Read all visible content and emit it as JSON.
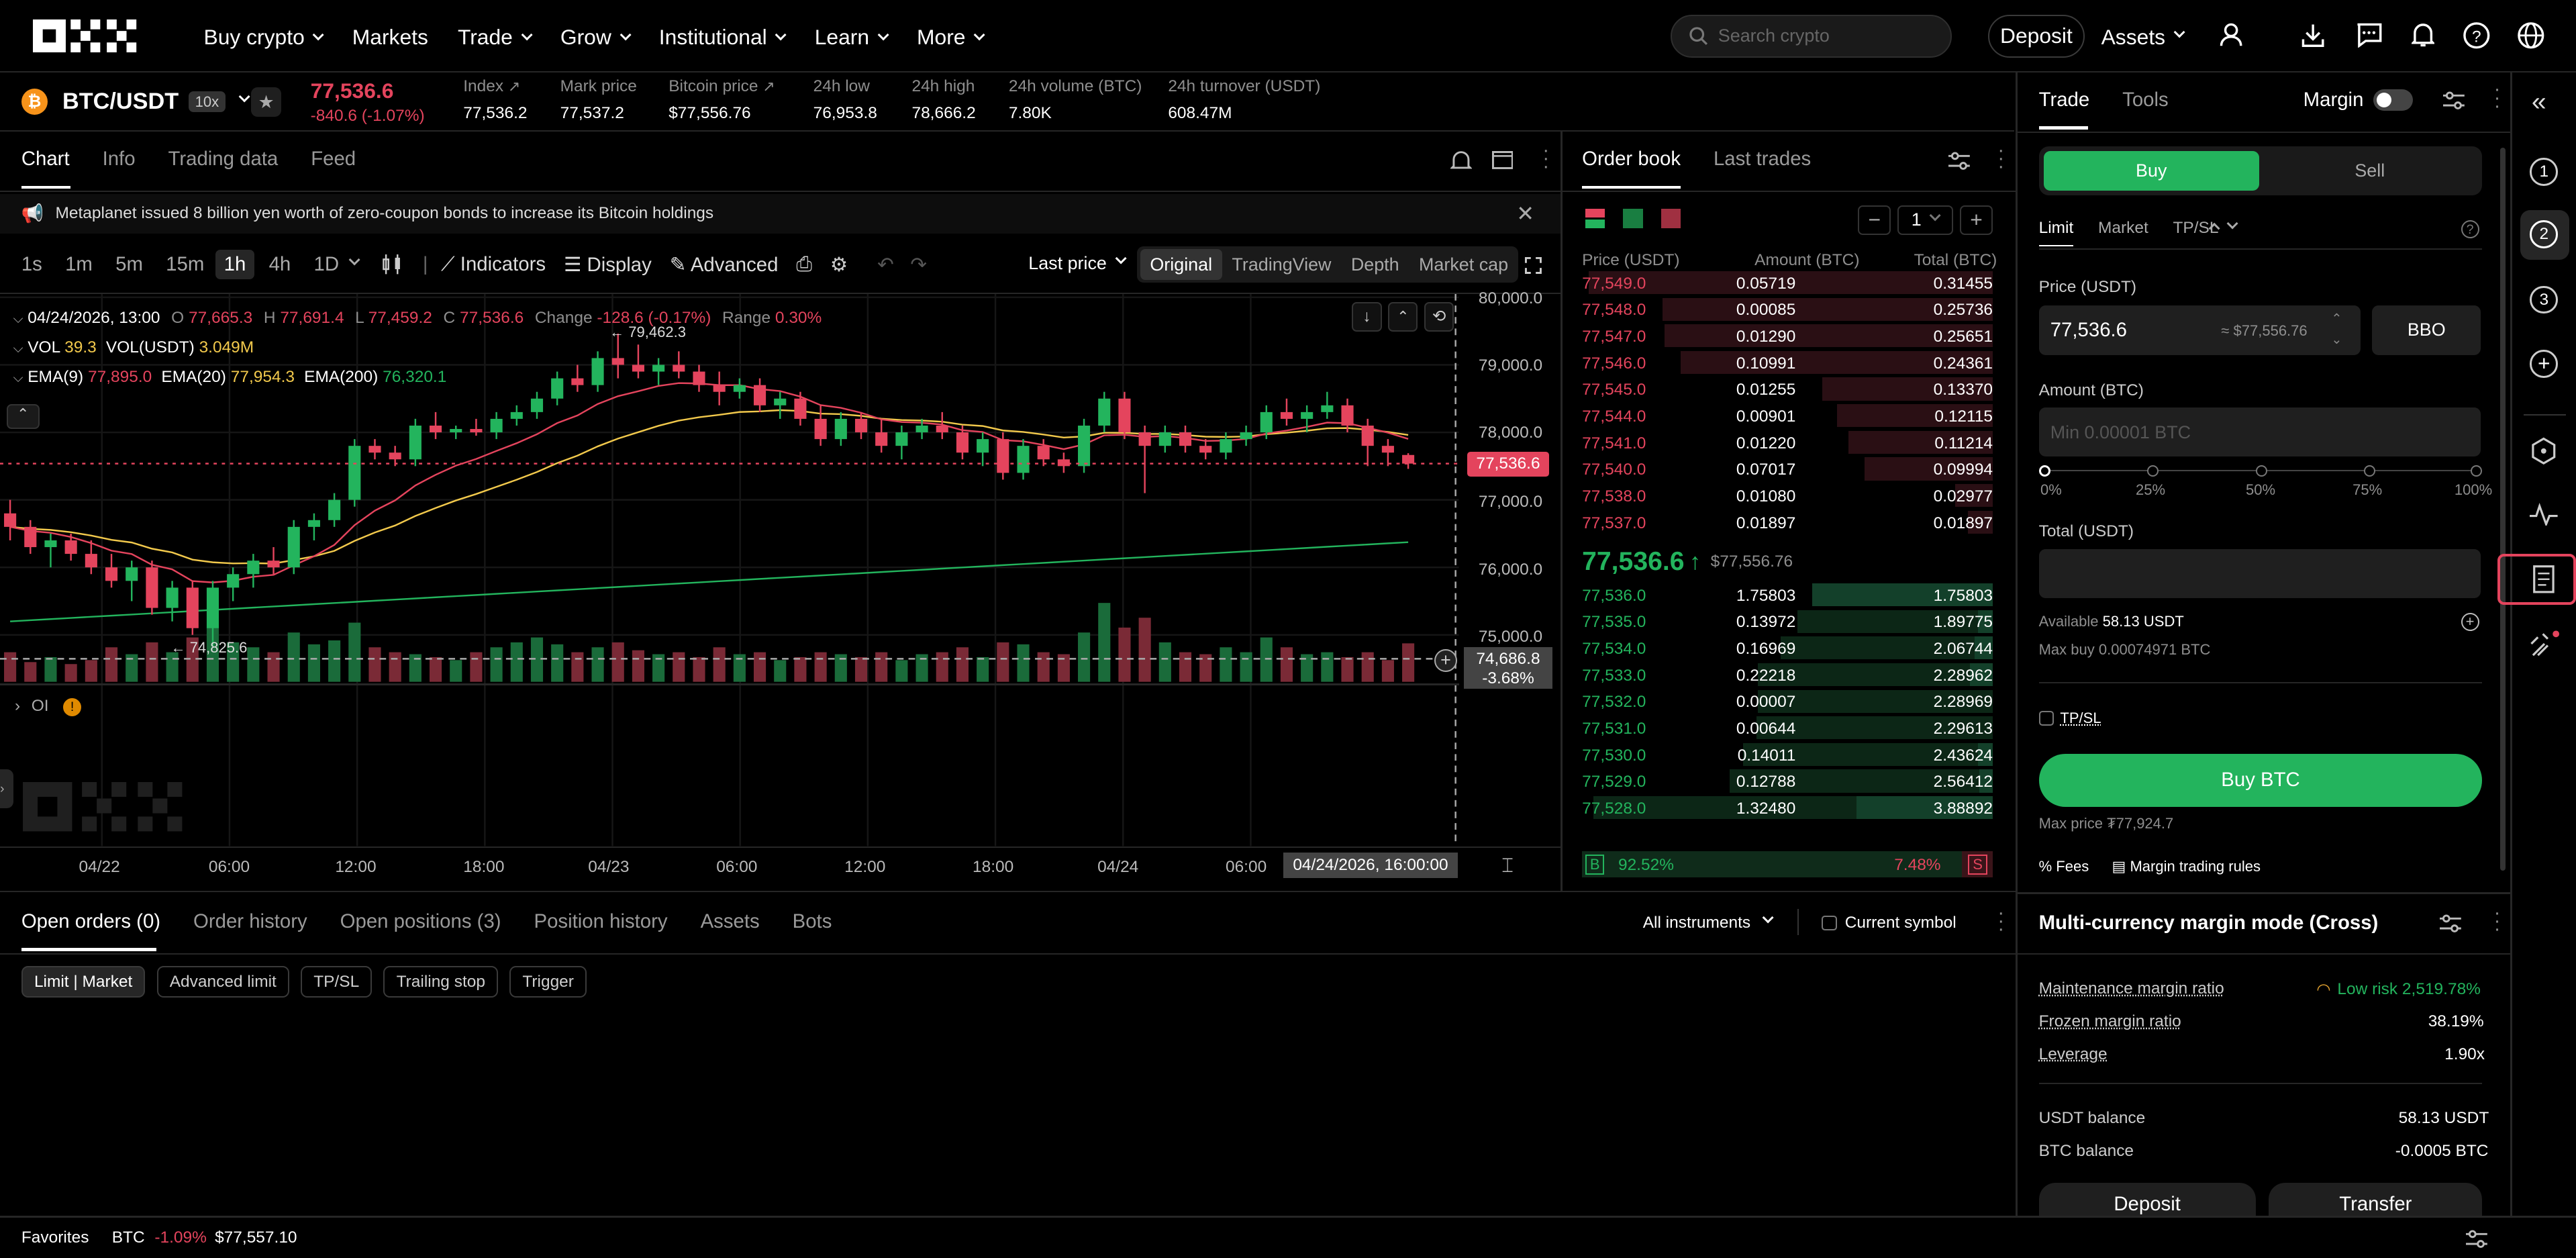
{
  "nav": {
    "logo": "OKX",
    "items": [
      "Buy crypto",
      "Markets",
      "Trade",
      "Grow",
      "Institutional",
      "Learn",
      "More"
    ],
    "search_placeholder": "Search crypto",
    "deposit": "Deposit",
    "assets": "Assets"
  },
  "ticker": {
    "pair": "BTC/USDT",
    "leverage": "10x",
    "price": "77,536.6",
    "change": "-840.6 (-1.07%)",
    "stats": [
      {
        "label": "Index",
        "value": "77,536.2"
      },
      {
        "label": "Mark price",
        "value": "77,537.2"
      },
      {
        "label": "Bitcoin price",
        "value": "$77,556.76"
      },
      {
        "label": "24h low",
        "value": "76,953.8"
      },
      {
        "label": "24h high",
        "value": "78,666.2"
      },
      {
        "label": "24h volume (BTC)",
        "value": "7.80K"
      },
      {
        "label": "24h turnover (USDT)",
        "value": "608.47M"
      }
    ]
  },
  "chart_panel": {
    "tabs": [
      "Chart",
      "Info",
      "Trading data",
      "Feed"
    ],
    "news": "Metaplanet issued 8 billion yen worth of zero-coupon bonds to increase its Bitcoin holdings",
    "intervals": [
      "1s",
      "1m",
      "5m",
      "15m",
      "1h",
      "4h",
      "1D"
    ],
    "tools": [
      "Indicators",
      "Display",
      "Advanced"
    ],
    "price_mode": "Last price",
    "views": [
      "Original",
      "TradingView",
      "Depth",
      "Market cap"
    ],
    "ohlc": {
      "date": "04/24/2026, 13:00",
      "o": "77,665.3",
      "h": "77,691.4",
      "l": "77,459.2",
      "c": "77,536.6",
      "change": "-128.6 (-0.17%)",
      "range": "0.30%"
    },
    "vol": {
      "label": "VOL",
      "btc": "39.3",
      "usdt_label": "VOL(USDT)",
      "usdt": "3.049M"
    },
    "ema": [
      {
        "label": "EMA(9)",
        "value": "77,895.0",
        "color": "#e4445d"
      },
      {
        "label": "EMA(20)",
        "value": "77,954.3",
        "color": "#f2c94c"
      },
      {
        "label": "EMA(200)",
        "value": "76,320.1",
        "color": "#23b45d"
      }
    ],
    "high_marker": "79,462.3",
    "low_marker": "74,825.6",
    "oi": "OI",
    "y_ticks": [
      "80,000.0",
      "79,000.0",
      "78,000.0",
      "77,000.0",
      "76,000.0",
      "75,000.0"
    ],
    "last_price_tag": "77,536.6",
    "cursor_price": "74,686.8",
    "cursor_pct": "-3.68%",
    "x_ticks": [
      "04/22",
      "06:00",
      "12:00",
      "18:00",
      "04/23",
      "06:00",
      "12:00",
      "18:00",
      "04/24",
      "06:00"
    ],
    "cursor_time": "04/24/2026, 16:00:00"
  },
  "chart_data": {
    "type": "candlestick",
    "title": "BTC/USDT 1h",
    "ylim": [
      74500,
      80000
    ],
    "candles": [
      [
        76800,
        77000,
        76400,
        76600
      ],
      [
        76600,
        76700,
        76200,
        76300
      ],
      [
        76300,
        76500,
        76000,
        76400
      ],
      [
        76400,
        76500,
        76100,
        76200
      ],
      [
        76200,
        76400,
        75900,
        76000
      ],
      [
        76000,
        76200,
        75700,
        75800
      ],
      [
        75800,
        76100,
        75500,
        76000
      ],
      [
        76000,
        76100,
        75300,
        75400
      ],
      [
        75400,
        75800,
        75200,
        75700
      ],
      [
        75700,
        75800,
        75000,
        75100
      ],
      [
        75100,
        75800,
        74826,
        75700
      ],
      [
        75700,
        76000,
        75500,
        75900
      ],
      [
        75900,
        76200,
        75700,
        76100
      ],
      [
        76100,
        76300,
        75900,
        76000
      ],
      [
        76000,
        76700,
        75900,
        76600
      ],
      [
        76600,
        76800,
        76400,
        76700
      ],
      [
        76700,
        77100,
        76600,
        77000
      ],
      [
        77000,
        77900,
        76900,
        77800
      ],
      [
        77800,
        77900,
        77600,
        77700
      ],
      [
        77700,
        77800,
        77500,
        77600
      ],
      [
        77600,
        78200,
        77500,
        78100
      ],
      [
        78100,
        78300,
        77900,
        78000
      ],
      [
        78000,
        78100,
        77900,
        78050
      ],
      [
        78050,
        78200,
        77950,
        78000
      ],
      [
        78000,
        78300,
        77900,
        78200
      ],
      [
        78200,
        78400,
        78100,
        78300
      ],
      [
        78300,
        78600,
        78200,
        78500
      ],
      [
        78500,
        78900,
        78400,
        78800
      ],
      [
        78800,
        79000,
        78600,
        78700
      ],
      [
        78700,
        79200,
        78600,
        79100
      ],
      [
        79100,
        79462,
        78800,
        79000
      ],
      [
        79000,
        79300,
        78800,
        78900
      ],
      [
        78900,
        79100,
        78700,
        79000
      ],
      [
        79000,
        79200,
        78800,
        78900
      ],
      [
        78900,
        79000,
        78600,
        78700
      ],
      [
        78700,
        78900,
        78400,
        78600
      ],
      [
        78600,
        78800,
        78500,
        78700
      ],
      [
        78700,
        78800,
        78300,
        78400
      ],
      [
        78400,
        78600,
        78200,
        78500
      ],
      [
        78500,
        78600,
        78100,
        78200
      ],
      [
        78200,
        78400,
        77800,
        77900
      ],
      [
        77900,
        78300,
        77800,
        78200
      ],
      [
        78200,
        78300,
        77900,
        78000
      ],
      [
        78000,
        78200,
        77700,
        77800
      ],
      [
        77800,
        78100,
        77600,
        78000
      ],
      [
        78000,
        78200,
        77900,
        78100
      ],
      [
        78100,
        78300,
        77900,
        78000
      ],
      [
        78000,
        78100,
        77600,
        77700
      ],
      [
        77700,
        78000,
        77500,
        77900
      ],
      [
        77900,
        78000,
        77300,
        77400
      ],
      [
        77400,
        77900,
        77300,
        77800
      ],
      [
        77800,
        77900,
        77500,
        77600
      ],
      [
        77600,
        77700,
        77400,
        77500
      ],
      [
        77500,
        78200,
        77400,
        78100
      ],
      [
        78100,
        78600,
        78000,
        78500
      ],
      [
        78500,
        78600,
        77900,
        78000
      ],
      [
        78000,
        78100,
        77100,
        77800
      ],
      [
        77800,
        78100,
        77700,
        78000
      ],
      [
        78000,
        78100,
        77700,
        77800
      ],
      [
        77800,
        77900,
        77600,
        77700
      ],
      [
        77700,
        78000,
        77600,
        77900
      ],
      [
        77900,
        78100,
        77800,
        78000
      ],
      [
        78000,
        78400,
        77900,
        78300
      ],
      [
        78300,
        78500,
        78100,
        78200
      ],
      [
        78200,
        78400,
        78000,
        78300
      ],
      [
        78300,
        78600,
        78200,
        78400
      ],
      [
        78400,
        78500,
        78000,
        78100
      ],
      [
        78100,
        78200,
        77500,
        77800
      ],
      [
        77800,
        77900,
        77500,
        77700
      ],
      [
        77665,
        77691,
        77459,
        77537
      ]
    ],
    "volume": [
      30,
      20,
      25,
      18,
      22,
      35,
      28,
      40,
      30,
      45,
      55,
      40,
      35,
      30,
      50,
      38,
      42,
      60,
      35,
      30,
      28,
      25,
      22,
      30,
      35,
      40,
      45,
      38,
      30,
      35,
      40,
      32,
      28,
      30,
      25,
      35,
      28,
      30,
      22,
      25,
      30,
      28,
      25,
      30,
      22,
      28,
      30,
      35,
      25,
      40,
      38,
      30,
      28,
      50,
      80,
      55,
      65,
      40,
      30,
      28,
      35,
      30,
      45,
      35,
      28,
      30,
      25,
      30,
      22,
      39
    ]
  },
  "order_book": {
    "tabs": [
      "Order book",
      "Last trades"
    ],
    "precision": "1",
    "headers": [
      "Price (USDT)",
      "Amount (BTC)",
      "Total (BTC)"
    ],
    "asks": [
      [
        "77,549.0",
        "0.05719",
        "0.31455"
      ],
      [
        "77,548.0",
        "0.00085",
        "0.25736"
      ],
      [
        "77,547.0",
        "0.01290",
        "0.25651"
      ],
      [
        "77,546.0",
        "0.10991",
        "0.24361"
      ],
      [
        "77,545.0",
        "0.01255",
        "0.13370"
      ],
      [
        "77,544.0",
        "0.00901",
        "0.12115"
      ],
      [
        "77,541.0",
        "0.01220",
        "0.11214"
      ],
      [
        "77,540.0",
        "0.07017",
        "0.09994"
      ],
      [
        "77,538.0",
        "0.01080",
        "0.02977"
      ],
      [
        "77,537.0",
        "0.01897",
        "0.01897"
      ]
    ],
    "mid_price": "77,536.6",
    "mid_usd": "$77,556.76",
    "bids": [
      [
        "77,536.0",
        "1.75803",
        "1.75803"
      ],
      [
        "77,535.0",
        "0.13972",
        "1.89775"
      ],
      [
        "77,534.0",
        "0.16969",
        "2.06744"
      ],
      [
        "77,533.0",
        "0.22218",
        "2.28962"
      ],
      [
        "77,532.0",
        "0.00007",
        "2.28969"
      ],
      [
        "77,531.0",
        "0.00644",
        "2.29613"
      ],
      [
        "77,530.0",
        "0.14011",
        "2.43624"
      ],
      [
        "77,529.0",
        "0.12788",
        "2.56412"
      ],
      [
        "77,528.0",
        "1.32480",
        "3.88892"
      ]
    ],
    "buy_pct": "92.52%",
    "sell_pct": "7.48%",
    "b": "B",
    "s": "S"
  },
  "trade_panel": {
    "tabs": [
      "Trade",
      "Tools"
    ],
    "margin_label": "Margin",
    "buy": "Buy",
    "sell": "Sell",
    "order_types": [
      "Limit",
      "Market",
      "TP/SL"
    ],
    "price_label": "Price (USDT)",
    "price_value": "77,536.6",
    "price_usd": "≈ $77,556.76",
    "bbo": "BBO",
    "amount_label": "Amount (BTC)",
    "amount_placeholder": "Min 0.00001 BTC",
    "slider": [
      "0%",
      "25%",
      "50%",
      "75%",
      "100%"
    ],
    "total_label": "Total (USDT)",
    "available_label": "Available",
    "available": "58.13 USDT",
    "max_buy": "Max buy 0.00074971 BTC",
    "tpsl": "TP/SL",
    "buy_button": "Buy BTC",
    "max_price": "Max price ₮77,924.7",
    "fees": "Fees",
    "rules": "Margin trading rules"
  },
  "margin_panel": {
    "title": "Multi-currency margin mode (Cross)",
    "rows": [
      {
        "label": "Maintenance margin ratio",
        "value": "Low risk 2,519.78%"
      },
      {
        "label": "Frozen margin ratio",
        "value": "38.19%"
      },
      {
        "label": "Leverage",
        "value": "1.90x"
      }
    ],
    "balances": [
      {
        "label": "USDT balance",
        "value": "58.13 USDT"
      },
      {
        "label": "BTC balance",
        "value": "-0.0005 BTC"
      }
    ],
    "deposit": "Deposit",
    "transfer": "Transfer"
  },
  "orders": {
    "tabs": [
      "Open orders (0)",
      "Order history",
      "Open positions (3)",
      "Position history",
      "Assets",
      "Bots"
    ],
    "filter": "All instruments",
    "current_symbol": "Current symbol",
    "chips": [
      "Limit | Market",
      "Advanced limit",
      "TP/SL",
      "Trailing stop",
      "Trigger"
    ]
  },
  "footer": {
    "favorites": "Favorites",
    "sym": "BTC",
    "change": "-1.09%",
    "price": "$77,557.10"
  },
  "right_rail": {
    "numbers": [
      "1",
      "2",
      "3"
    ]
  }
}
